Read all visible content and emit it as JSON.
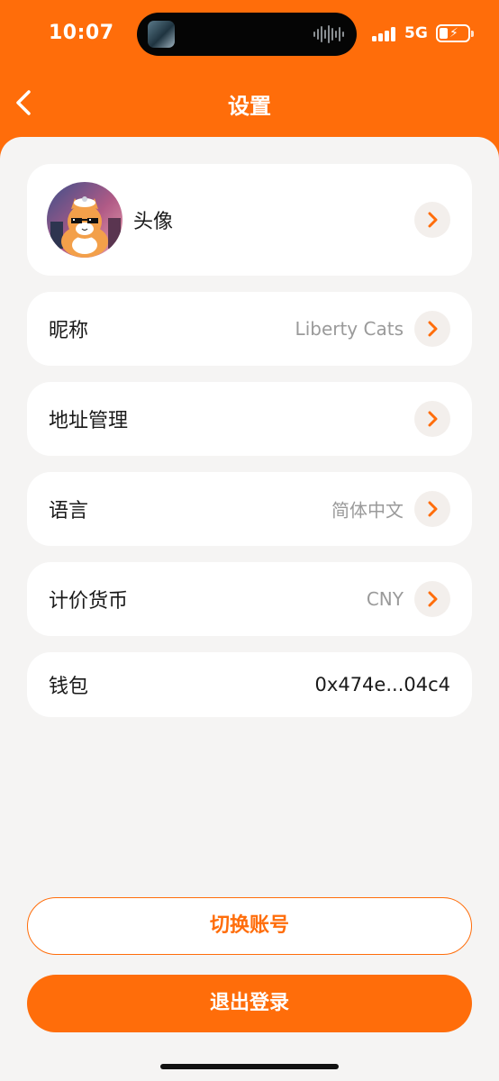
{
  "status_bar": {
    "time": "10:07",
    "network": "5G"
  },
  "header": {
    "title": "设置",
    "back_icon": "chevron-left-icon"
  },
  "settings": {
    "avatar": {
      "label": "头像"
    },
    "nickname": {
      "label": "昵称",
      "value": "Liberty Cats"
    },
    "address": {
      "label": "地址管理"
    },
    "language": {
      "label": "语言",
      "value": "简体中文"
    },
    "currency": {
      "label": "计价货币",
      "value": "CNY"
    },
    "wallet": {
      "label": "钱包",
      "value": "0x474e...04c4"
    }
  },
  "actions": {
    "switch_account": "切换账号",
    "logout": "退出登录"
  },
  "colors": {
    "accent": "#ff6d0a",
    "background": "#f5f4f3",
    "card": "#ffffff",
    "muted_text": "#9a9a9a"
  }
}
